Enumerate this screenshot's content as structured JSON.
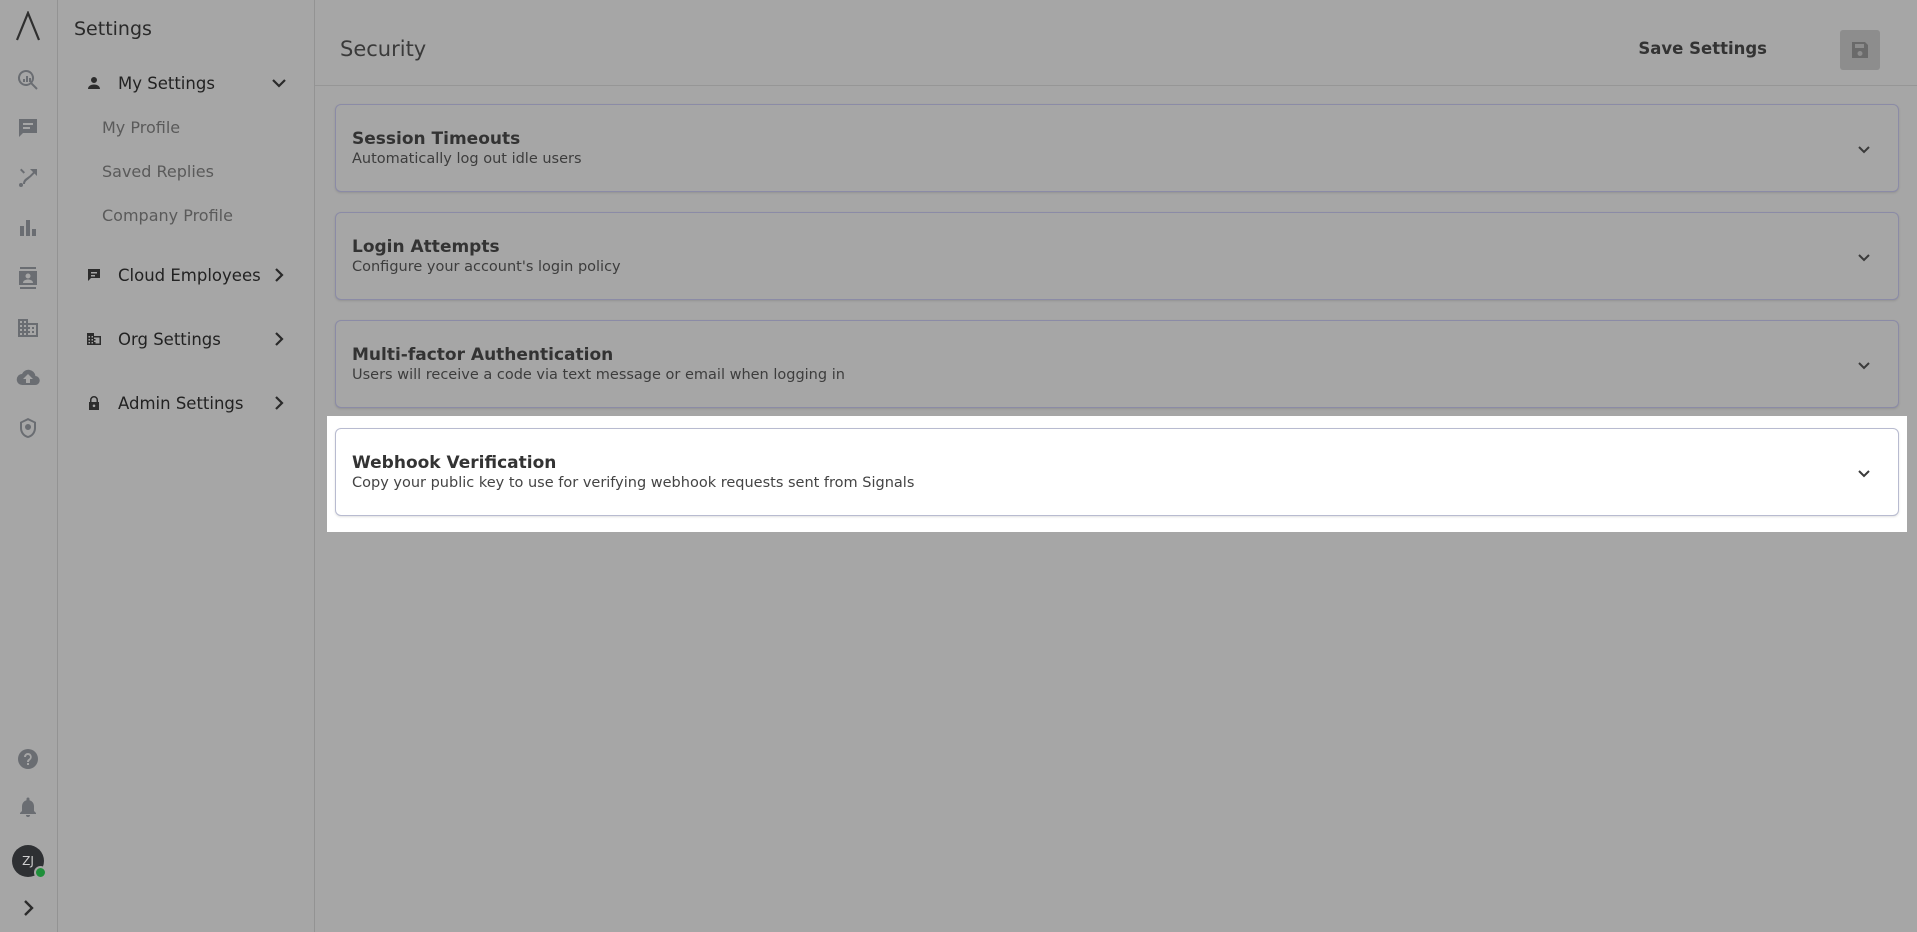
{
  "rail": {
    "icons": [
      "logo-icon",
      "search-analytics-icon",
      "chat-icon",
      "routing-icon",
      "bar-chart-icon",
      "contacts-icon",
      "building-icon",
      "cloud-upload-icon",
      "badge-icon",
      "help-icon",
      "bell-icon",
      "expand-icon"
    ],
    "avatar_initials": "ZJ"
  },
  "sidebar": {
    "title": "Settings",
    "my_settings": {
      "label": "My Settings",
      "items": [
        "My Profile",
        "Saved Replies",
        "Company Profile"
      ]
    },
    "cloud_employees": "Cloud Employees",
    "org_settings": "Org Settings",
    "admin_settings": "Admin Settings"
  },
  "header": {
    "title": "Security",
    "save_label": "Save Settings"
  },
  "panels": [
    {
      "title": "Session Timeouts",
      "description": "Automatically log out idle users"
    },
    {
      "title": "Login Attempts",
      "description": "Configure your account's login policy"
    },
    {
      "title": "Multi-factor Authentication",
      "description": "Users will receive a code via text message or email when logging in"
    },
    {
      "title": "Webhook Verification",
      "description": "Copy your public key to use for verifying webhook requests sent from Signals"
    }
  ],
  "colors": {
    "background": "#a6a6a6",
    "highlight": "#ffffff",
    "status_online": "#1f8f3a"
  }
}
